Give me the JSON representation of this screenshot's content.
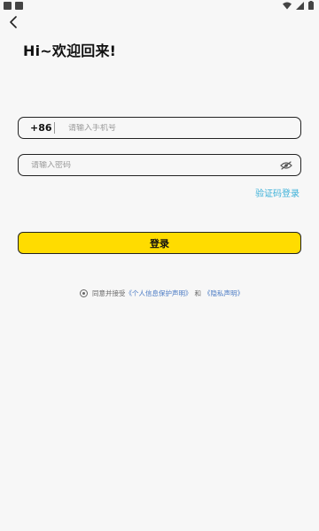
{
  "status_bar": {
    "icons": [
      "notification-icon",
      "app-icon",
      "wifi-icon",
      "signal-icon",
      "battery-icon"
    ]
  },
  "header": {
    "back_icon": "chevron-left-icon",
    "title": "Hi~欢迎回来!"
  },
  "phone_field": {
    "country_code": "+86",
    "placeholder": "请输入手机号",
    "value": ""
  },
  "password_field": {
    "placeholder": "请输入密码",
    "value": "",
    "toggle_icon": "eye-off-icon"
  },
  "sms_login_label": "验证码登录",
  "login_button_label": "登录",
  "agreement": {
    "checked": true,
    "prefix": "同意并接受",
    "privacy_protection_link": "《个人信息保护声明》",
    "connector": "和",
    "privacy_policy_link": "《隐私声明》"
  },
  "colors": {
    "background": "#f7f7f7",
    "login_button": "#ffdc00",
    "sms_link": "#3bb0d8",
    "policy_link": "#4b7bc4",
    "border": "#222222"
  }
}
